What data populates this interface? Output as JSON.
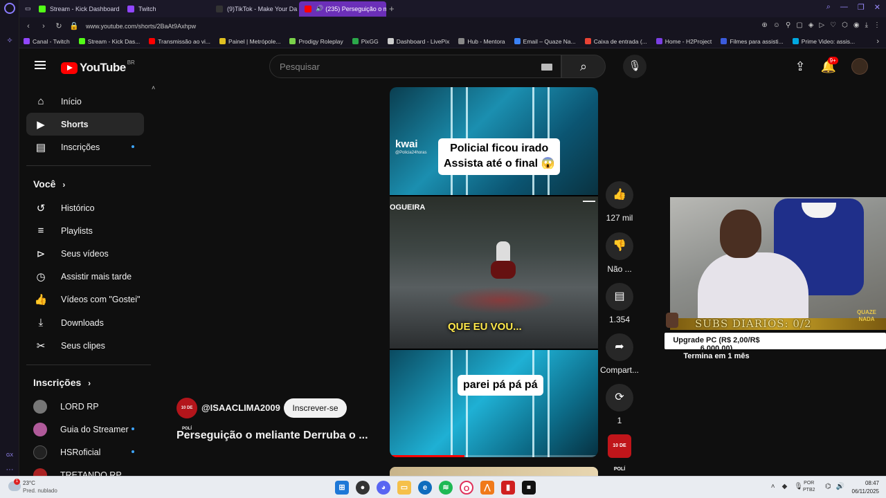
{
  "browser": {
    "tabs": [
      {
        "label": "Stream - Kick Dashboard",
        "color": "#53fc18"
      },
      {
        "label": "Twitch",
        "color": "#9146ff"
      },
      {
        "label": "(9)TikTok - Make Your Da",
        "color": "#111111"
      },
      {
        "label": "(235) Perseguição o m",
        "color": "#ff0000",
        "active": true
      }
    ],
    "url": "www.youtube.com/shorts/2BaAt9Axhpw",
    "bookmarks": [
      {
        "label": "Canal - Twitch",
        "color": "#9146ff"
      },
      {
        "label": "Stream - Kick Das...",
        "color": "#53fc18"
      },
      {
        "label": "Transmissão ao vi...",
        "color": "#ff0000"
      },
      {
        "label": "Painel | Metrópole...",
        "color": "#e0c020"
      },
      {
        "label": "Prodigy Roleplay",
        "color": "#7ad14a"
      },
      {
        "label": "PixGG",
        "color": "#2ba84a"
      },
      {
        "label": "Dashboard - LivePix",
        "color": "#cccccc"
      },
      {
        "label": "Hub - Mentora",
        "color": "#888888"
      },
      {
        "label": "Email – Quaze Na...",
        "color": "#3b82f6"
      },
      {
        "label": "Caixa de entrada (...",
        "color": "#ea4335"
      },
      {
        "label": "Home - H2Project",
        "color": "#7b3fe4"
      },
      {
        "label": "Filmes para assisti...",
        "color": "#3b5bdb"
      },
      {
        "label": "Prime Video: assis...",
        "color": "#00a8e1"
      }
    ]
  },
  "youtube": {
    "logo_text": "YouTube",
    "country": "BR",
    "search_placeholder": "Pesquisar",
    "notif_count": "9+",
    "sidebar": {
      "main": [
        {
          "label": "Início",
          "icon": "home-icon"
        },
        {
          "label": "Shorts",
          "icon": "shorts-icon",
          "active": true
        },
        {
          "label": "Inscrições",
          "icon": "subscriptions-icon",
          "dot": true
        }
      ],
      "you_heading": "Você",
      "you": [
        {
          "label": "Histórico",
          "icon": "history-icon"
        },
        {
          "label": "Playlists",
          "icon": "playlists-icon"
        },
        {
          "label": "Seus vídeos",
          "icon": "your-videos-icon"
        },
        {
          "label": "Assistir mais tarde",
          "icon": "watch-later-icon"
        },
        {
          "label": "Vídeos com \"Gostei\"",
          "icon": "liked-icon"
        },
        {
          "label": "Downloads",
          "icon": "download-icon"
        },
        {
          "label": "Seus clipes",
          "icon": "scissors-icon"
        }
      ],
      "subs_heading": "Inscrições",
      "subs": [
        {
          "label": "LORD RP",
          "color": "#777777"
        },
        {
          "label": "Guia do Streamer",
          "color": "#b05a9a",
          "dot": true
        },
        {
          "label": "HSRoficial",
          "color": "#222222",
          "dot": true
        },
        {
          "label": "TRETANDO RP",
          "color": "#aa2222"
        }
      ]
    },
    "short": {
      "caption_top_line1": "Policial ficou irado",
      "caption_top_line2": "Assista até o final 😱",
      "kwai": "kwai",
      "kwai_handle": "@Policia24horas",
      "mid_label": "OGUEIRA",
      "mid_caption": "QUE EU VOU...",
      "caption_bottom": "parei pá pá pá",
      "progress": 0.36,
      "channel": "@ISAACLIMA2009",
      "channel_avatar_text": "10 DE POLÍ",
      "subscribe": "Inscrever-se",
      "title": "Perseguição o meliante Derruba o ..."
    },
    "actions": {
      "likes": "127 mil",
      "dislike": "Não ...",
      "comments": "1.354",
      "share": "Compart...",
      "remix": "1"
    }
  },
  "overlay": {
    "subs_text": "SUBS DIARIOS: 0/2",
    "brand": "QUAZE NADA",
    "goal_label": "Upgrade PC (R$ 2,00/R$ 6.000,00)",
    "goal_ends": "Termina em 1 mês"
  },
  "taskbar": {
    "temp": "23°C",
    "condition": "Pred. nublado",
    "weather_badge": "1",
    "lang1": "POR",
    "lang2": "PTB2",
    "time": "08:47",
    "date": "06/11/2025"
  }
}
